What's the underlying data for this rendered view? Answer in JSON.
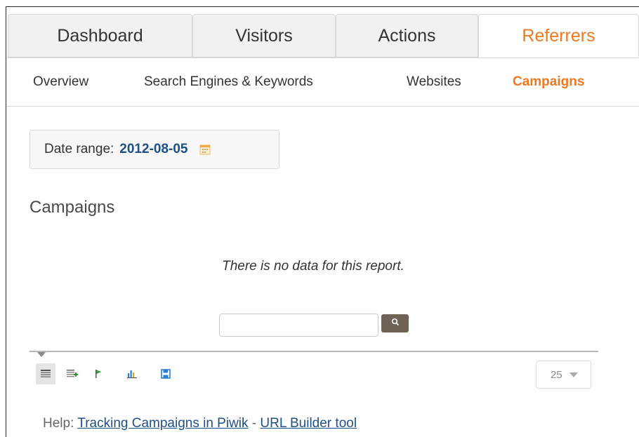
{
  "main_tabs": [
    {
      "label": "Dashboard",
      "active": false
    },
    {
      "label": "Visitors",
      "active": false
    },
    {
      "label": "Actions",
      "active": false
    },
    {
      "label": "Referrers",
      "active": true
    }
  ],
  "sub_tabs": [
    {
      "label": "Overview",
      "active": false
    },
    {
      "label": "Search Engines & Keywords",
      "active": false
    },
    {
      "label": "Websites",
      "active": false
    },
    {
      "label": "Campaigns",
      "active": true
    }
  ],
  "date_range": {
    "label": "Date range:",
    "value": "2012-08-05",
    "icon": "calendar-icon"
  },
  "report": {
    "title": "Campaigns",
    "empty_message": "There is no data for this report."
  },
  "search": {
    "value": "",
    "placeholder": "",
    "button_icon": "search-icon"
  },
  "visualizations": [
    {
      "name": "table-view-icon",
      "selected": true
    },
    {
      "name": "table-more-columns-icon",
      "selected": false
    },
    {
      "name": "goals-flag-icon",
      "selected": false
    },
    {
      "name": "bar-chart-icon",
      "selected": false
    },
    {
      "name": "export-icon",
      "selected": false
    }
  ],
  "limit": {
    "value": "25"
  },
  "help": {
    "prefix": "Help:",
    "link1": "Tracking Campaigns in Piwik",
    "separator": " - ",
    "link2": "URL Builder tool"
  },
  "colors": {
    "accent": "#f0781e",
    "link": "#1d4f8a",
    "tab_bg": "#f1f1f1"
  }
}
